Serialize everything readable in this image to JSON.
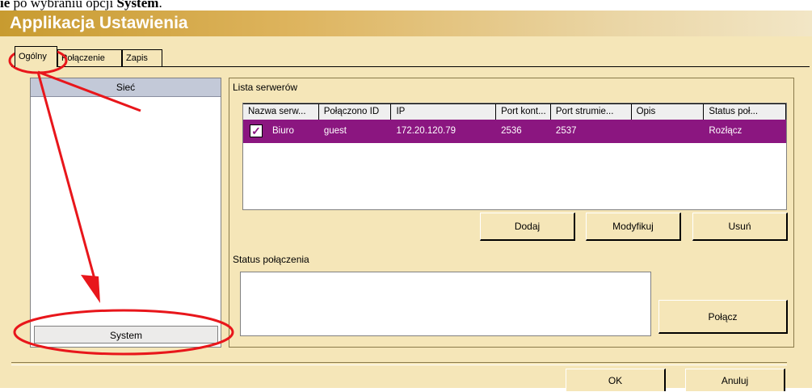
{
  "caption": {
    "prefix": "ie",
    "middle": " po wybraniu opcji ",
    "bold": "System",
    "suffix": "."
  },
  "window": {
    "title": "Applikacja Ustawienia"
  },
  "tabs": [
    {
      "label": "Ogólny",
      "active": true
    },
    {
      "label": "Połączenie",
      "active": false
    },
    {
      "label": "Zapis",
      "active": false
    }
  ],
  "side_list": {
    "header": "Sieć",
    "footer": "System"
  },
  "servers": {
    "group_label": "Lista serwerów",
    "columns": [
      "Nazwa serw...",
      "Połączono ID",
      "IP",
      "Port kont...",
      "Port strumie...",
      "Opis",
      "Status poł..."
    ],
    "rows": [
      {
        "checked": true,
        "name": "Biuro",
        "user": "guest",
        "ip": "172.20.120.79",
        "port_control": "2536",
        "port_stream": "2537",
        "description": "",
        "status": "Rozłącz"
      }
    ],
    "buttons": {
      "add": "Dodaj",
      "modify": "Modyfikuj",
      "remove": "Usuń"
    }
  },
  "connection_status": {
    "label": "Status połączenia",
    "value": "",
    "connect_button": "Połącz"
  },
  "footer": {
    "ok": "OK",
    "cancel": "Anuluj"
  },
  "colors": {
    "window_bg": "#f5e6b8",
    "selection": "#8b1680",
    "annotation": "#e8161b"
  }
}
